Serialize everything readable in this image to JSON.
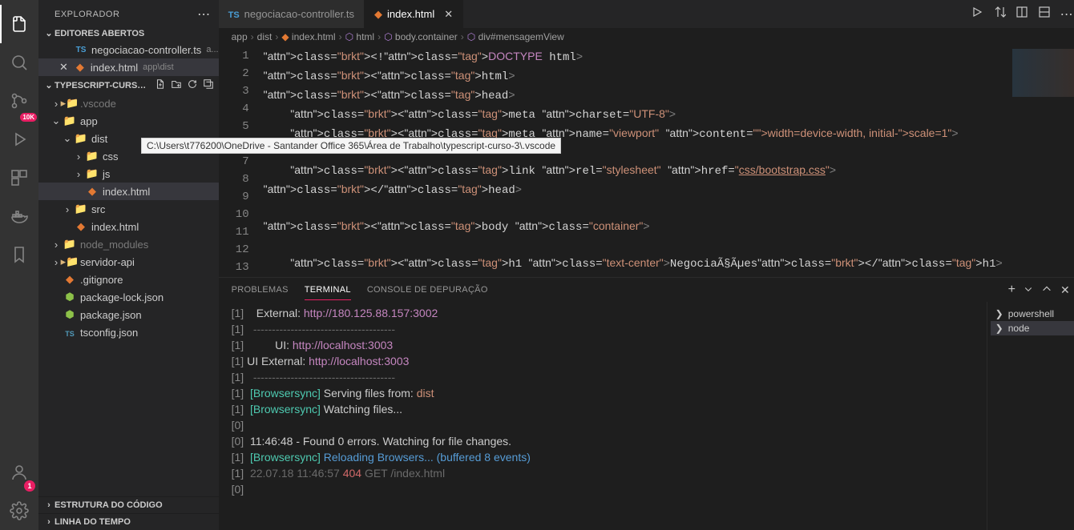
{
  "explorer": {
    "title": "EXPLORADOR",
    "openEditors": "EDITORES ABERTOS",
    "outline": "ESTRUTURA DO CÓDIGO",
    "timeline": "LINHA DO TEMPO",
    "workspace": "TYPESCRIPT-CURS…",
    "editors": [
      {
        "name": "negociacao-controller.ts",
        "desc": "a...",
        "icon": "ts"
      },
      {
        "name": "index.html",
        "desc": "app\\dist",
        "icon": "html",
        "active": true
      }
    ],
    "tree": [
      {
        "depth": 0,
        "twist": "right",
        "icon": "folder",
        "label": ".vscode",
        "dim": true
      },
      {
        "depth": 0,
        "twist": "down",
        "icon": "folder-red",
        "label": "app"
      },
      {
        "depth": 1,
        "twist": "down",
        "icon": "folder-red",
        "label": "dist"
      },
      {
        "depth": 2,
        "twist": "right",
        "icon": "folder-css",
        "label": "css"
      },
      {
        "depth": 2,
        "twist": "right",
        "icon": "folder-js",
        "label": "js"
      },
      {
        "depth": 2,
        "twist": "",
        "icon": "html",
        "label": "index.html",
        "selected": true
      },
      {
        "depth": 1,
        "twist": "right",
        "icon": "folder-src",
        "label": "src"
      },
      {
        "depth": 1,
        "twist": "",
        "icon": "html",
        "label": "index.html"
      },
      {
        "depth": 0,
        "twist": "right",
        "icon": "folder-npm",
        "label": "node_modules",
        "dim": true
      },
      {
        "depth": 0,
        "twist": "right",
        "icon": "folder",
        "label": "servidor-api"
      },
      {
        "depth": 0,
        "twist": "",
        "icon": "git",
        "label": ".gitignore"
      },
      {
        "depth": 0,
        "twist": "",
        "icon": "npm",
        "label": "package-lock.json"
      },
      {
        "depth": 0,
        "twist": "",
        "icon": "npm",
        "label": "package.json"
      },
      {
        "depth": 0,
        "twist": "",
        "icon": "tsc",
        "label": "tsconfig.json"
      }
    ]
  },
  "tooltip": "C:\\Users\\t776200\\OneDrive - Santander Office 365\\Área de Trabalho\\typescript-curso-3\\.vscode",
  "tabs": [
    {
      "icon": "ts",
      "label": "negociacao-controller.ts"
    },
    {
      "icon": "html",
      "label": "index.html",
      "active": true
    }
  ],
  "breadcrumb": {
    "parts": [
      "app",
      "dist",
      "index.html",
      "html",
      "body.container",
      "div#mensagemView"
    ]
  },
  "code": {
    "lines": [
      "<!DOCTYPE html>",
      "<html>",
      "<head>",
      "    <meta charset=\"UTF-8\">",
      "    <meta name=\"viewport\" content=\"width=device-width, initial-scale=1\">",
      "",
      "    <link rel=\"stylesheet\" href=\"css/bootstrap.css\">",
      "</head>",
      "",
      "<body class=\"container\">",
      "",
      "    <h1 class=\"text-center\">NegociaÃ§Ãµes</h1>",
      ""
    ]
  },
  "panel": {
    "tabs": {
      "problems": "PROBLEMAS",
      "terminal": "TERMINAL",
      "debug": "CONSOLE DE DEPURAÇÃO"
    },
    "terminalOutput": [
      {
        "idx": "[1]",
        "label": "   External:",
        "url": " http://180.125.88.157:3002"
      },
      {
        "idx": "[1]",
        "dim": "  --------------------------------------"
      },
      {
        "idx": "[1]",
        "label": "         UI:",
        "url": " http://localhost:3003"
      },
      {
        "idx": "[1]",
        "label": "UI External:",
        "url": " http://localhost:3003"
      },
      {
        "idx": "[1]",
        "dim": "  --------------------------------------"
      },
      {
        "idx": "[1]",
        "bsync": "[Browsersync]",
        "text": " Serving files from: ",
        "warn": "dist"
      },
      {
        "idx": "[1]",
        "bsync": "[Browsersync]",
        "text": " Watching files..."
      },
      {
        "idx": "[0]"
      },
      {
        "idx": "[0]",
        "text": " 11:46:48 - Found 0 errors. Watching for file changes."
      },
      {
        "idx": "[1]",
        "bsync": "[Browsersync]",
        "info": " Reloading Browsers... (buffered 8 events)"
      },
      {
        "idx": "[1]",
        "dim2": " 22.07.18 11:46:57 ",
        "err": "404",
        "dim3": " GET /index.html"
      },
      {
        "idx": "[0]"
      }
    ],
    "shells": [
      {
        "label": "powershell"
      },
      {
        "label": "node",
        "active": true
      }
    ]
  },
  "badges": {
    "tenk": "10K",
    "one": "1"
  }
}
